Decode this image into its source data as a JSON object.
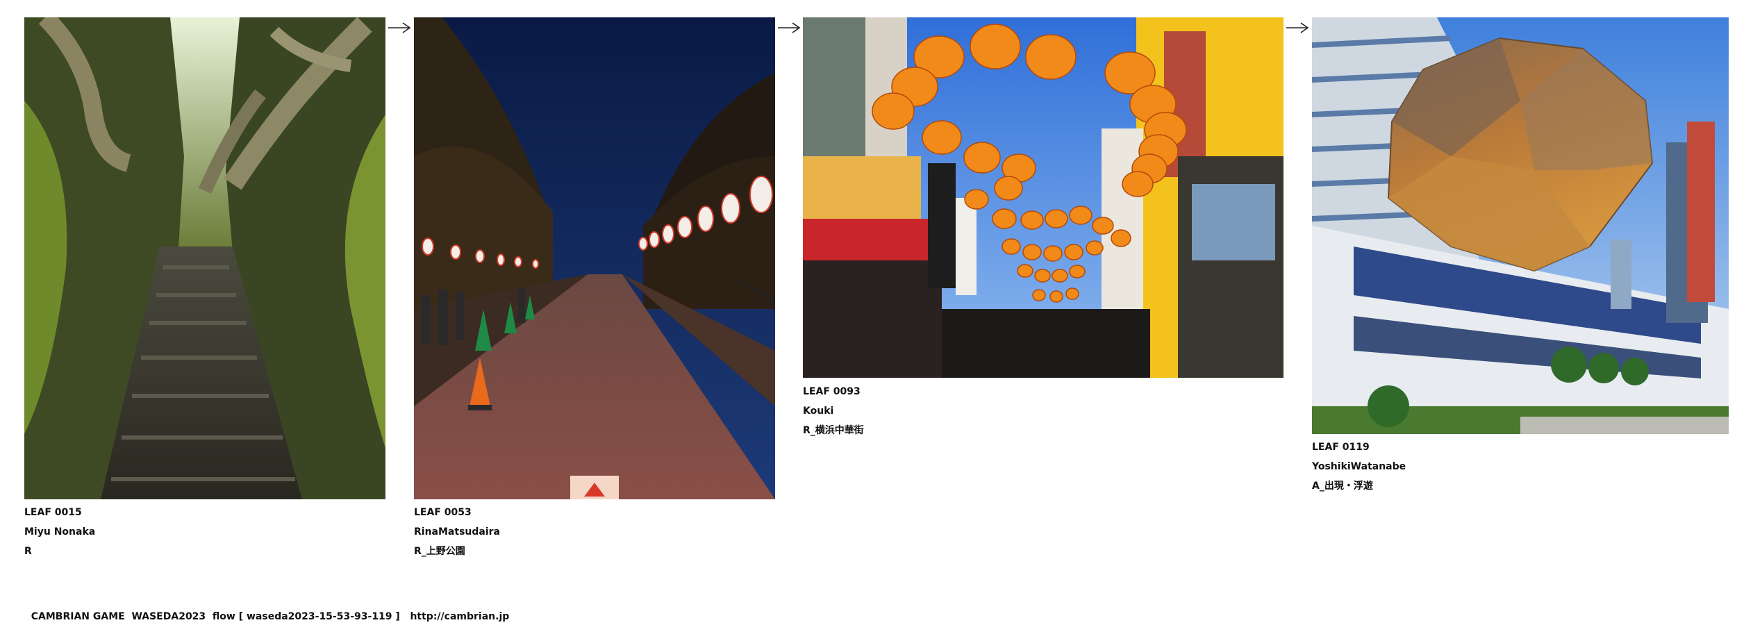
{
  "items": [
    {
      "id": "LEAF 0015",
      "author": "Miyu Nonaka",
      "tag": "R",
      "image_icon": "stone-stairs-forest-image"
    },
    {
      "id": "LEAF 0053",
      "author": "RinaMatsudaira",
      "tag": "R_上野公園",
      "image_icon": "lantern-park-night-image"
    },
    {
      "id": "LEAF 0093",
      "author": "Kouki",
      "tag": "R_横浜中華街",
      "image_icon": "chinatown-lanterns-image"
    },
    {
      "id": "LEAF 0119",
      "author": "YoshikiWatanabe",
      "tag": "A_出現・浮遊",
      "image_icon": "floating-rock-building-image"
    }
  ],
  "arrow_icon": "right-arrow-icon",
  "footer": {
    "text": "CAMBRIAN GAME  WASEDA2023  flow [ waseda2023-15-53-93-119 ]",
    "link": "http://cambrian.jp"
  },
  "colors": {
    "background": "#ffffff",
    "text": "#111111",
    "lantern_orange": "#f28a1a",
    "sky_night": "#10204a",
    "sky_day": "#4f8fe0",
    "moss_green": "#6f8a2a",
    "rock_bronze": "#b97a3a"
  }
}
